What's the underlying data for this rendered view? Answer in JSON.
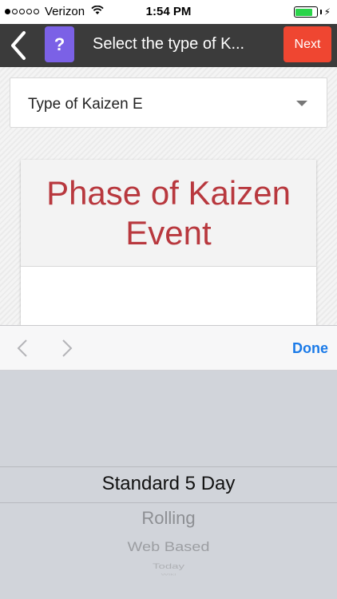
{
  "status_bar": {
    "carrier": "Verizon",
    "time": "1:54 PM",
    "signal_bars_filled": 1,
    "signal_bars_total": 5,
    "battery_level": 0.85,
    "battery_color": "#2bd44a"
  },
  "nav": {
    "back_icon": "chevron-left-icon",
    "help_label": "?",
    "title": "Select the type of K...",
    "next_label": "Next",
    "help_color": "#7b61e6",
    "next_color": "#ef4631"
  },
  "dropdown": {
    "value": "Type of Kaizen E",
    "caret_icon": "caret-down-icon"
  },
  "card": {
    "title": "Phase of Kaizen Event",
    "title_color": "#b8383e"
  },
  "picker_toolbar": {
    "prev_icon": "chevron-left-icon",
    "next_icon": "chevron-right-icon",
    "done_label": "Done",
    "done_color": "#1a7ae8"
  },
  "picker": {
    "options": [
      "Standard 5 Day",
      "Rolling",
      "Web Based",
      "Today",
      "Wiki"
    ],
    "selected": "Standard 5 Day"
  }
}
